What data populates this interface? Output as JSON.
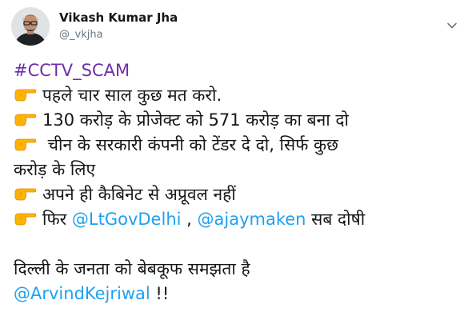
{
  "author": {
    "name": "Vikash Kumar Jha",
    "handle": "@_vkjha"
  },
  "tweet": {
    "hashtag": "#CCTV_SCAM",
    "line1": "पहले चार साल कुछ मत करो.",
    "line2": "130 करोड़ के प्रोजेक्ट को 571 करोड़ का बना दो",
    "line3a": " चीन के सरकारी कंपनी को टेंडर दे दो, सिर्फ कुछ",
    "line3b": "करोड़ के लिए",
    "line4": "अपने ही कैबिनेट से अप्रूवल नहीं",
    "line5_prefix": "फिर ",
    "mention_ltgov": "@LtGovDelhi",
    "line5_sep": " , ",
    "mention_ajay": "@ajaymaken",
    "line5_suffix": " सब दोषी",
    "line6": "दिल्ली के जनता को बेबकूफ समझता है",
    "mention_arvind": "@ArvindKejriwal",
    "line7_suffix": " !!"
  },
  "icons": {
    "pointing": "backhand-index-pointing-right-icon",
    "menu": "chevron-down-icon"
  },
  "colors": {
    "hashtag": "#6f2da8",
    "link": "#1da1f2",
    "text": "#14171a",
    "muted": "#657786",
    "emoji": "#ffb300"
  }
}
